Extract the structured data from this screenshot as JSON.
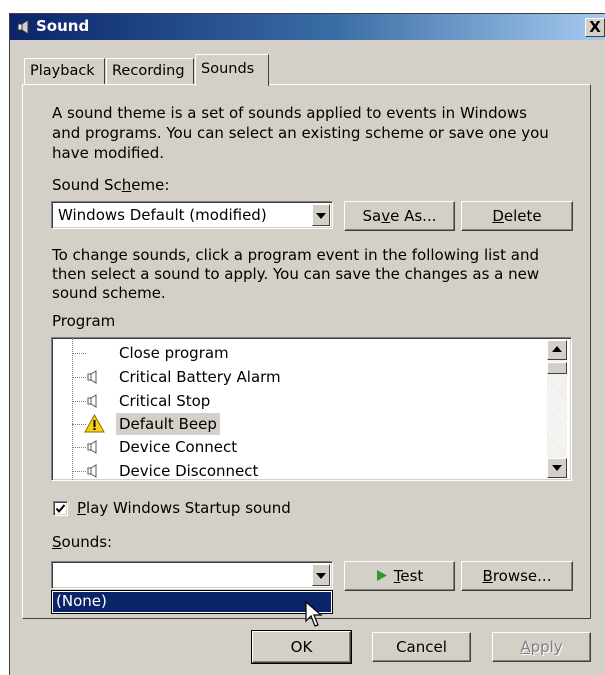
{
  "window": {
    "title": "Sound",
    "close_label": "X"
  },
  "tabs": [
    {
      "label": "Playback"
    },
    {
      "label": "Recording"
    },
    {
      "label": "Sounds",
      "selected": true
    }
  ],
  "intro_text": [
    "A sound theme is a set of sounds applied to events in Windows",
    "and programs.  You can select an existing scheme or save one you",
    "have modified."
  ],
  "scheme": {
    "label_pre": "Sound Sc",
    "label_ul": "h",
    "label_post": "eme:",
    "value": "Windows Default (modified)",
    "save_as_pre": "Sa",
    "save_as_ul": "v",
    "save_as_post": "e As...",
    "delete_ul": "D",
    "delete_post": "elete"
  },
  "change_text": [
    "To change sounds, click a program event in the following list and",
    "then select a sound to apply.  You can save the changes as a new",
    "sound scheme."
  ],
  "program": {
    "label": "Program",
    "items": [
      {
        "label": "Close program",
        "icon": "none"
      },
      {
        "label": "Critical Battery Alarm",
        "icon": "speaker-icon"
      },
      {
        "label": "Critical Stop",
        "icon": "speaker-icon"
      },
      {
        "label": "Default Beep",
        "icon": "warning-icon",
        "selected": true
      },
      {
        "label": "Device Connect",
        "icon": "speaker-icon"
      },
      {
        "label": "Device Disconnect",
        "icon": "speaker-icon"
      }
    ]
  },
  "startup": {
    "checked": true,
    "label_ul": "P",
    "label_post": "lay Windows Startup sound"
  },
  "sounds": {
    "label_ul": "S",
    "label_post": "ounds:",
    "value": "",
    "dropdown_option": "(None)",
    "test_ul": "T",
    "test_post": "est",
    "browse_ul": "B",
    "browse_post": "rowse..."
  },
  "footer": {
    "ok": "OK",
    "cancel": "Cancel",
    "apply_ul": "A",
    "apply_post": "pply"
  },
  "colors": {
    "title_start": "#0a246a",
    "title_end": "#a6caf0",
    "selection": "#0a246a",
    "face": "#d4d0c8",
    "test_arrow": "#2e9a2e"
  }
}
